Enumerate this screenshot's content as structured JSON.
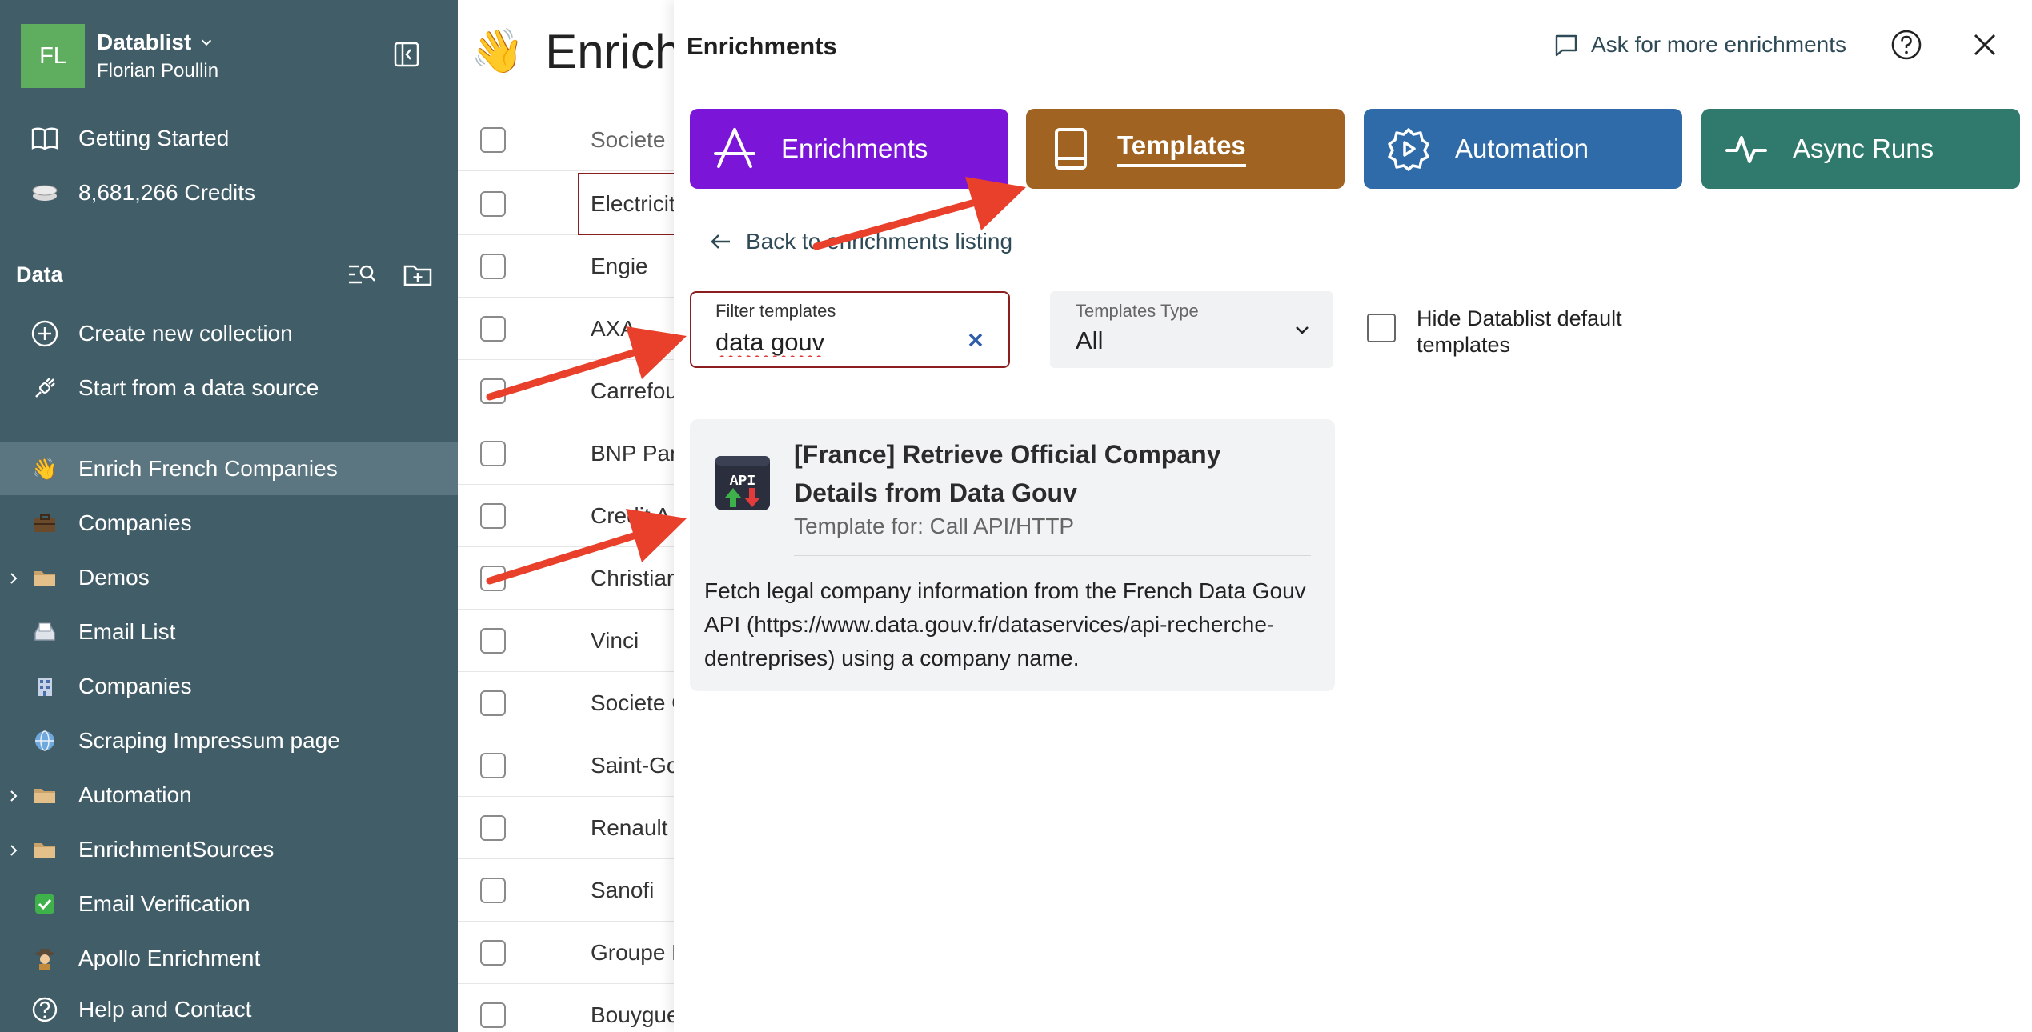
{
  "user": {
    "initials": "FL",
    "workspace": "Datablist",
    "name": "Florian Poullin"
  },
  "sidebar": {
    "top_items": [
      {
        "label": "Getting Started",
        "icon": "book-icon"
      },
      {
        "label": "8,681,266 Credits",
        "icon": "coins-icon"
      }
    ],
    "section_title": "Data",
    "actions": [
      {
        "label": "Create new collection",
        "icon": "plus-circle-icon"
      },
      {
        "label": "Start from a data source",
        "icon": "plug-icon"
      }
    ],
    "collections": [
      {
        "label": "Enrich French Companies",
        "icon": "waving-hand-icon",
        "active": true
      },
      {
        "label": "Companies",
        "icon": "briefcase-icon"
      },
      {
        "label": "Demos",
        "icon": "folder-icon",
        "folder": true
      },
      {
        "label": "Email List",
        "icon": "inbox-tray-icon"
      },
      {
        "label": "Companies",
        "icon": "office-building-icon"
      },
      {
        "label": "Scraping Impressum page",
        "icon": "globe-icon"
      },
      {
        "label": "Automation",
        "icon": "folder-icon",
        "folder": true
      },
      {
        "label": "EnrichmentSources",
        "icon": "folder-icon",
        "folder": true
      },
      {
        "label": "Email Verification",
        "icon": "check-mark-icon"
      },
      {
        "label": "Apollo Enrichment",
        "icon": "detective-icon"
      }
    ],
    "help_label": "Help and Contact"
  },
  "main": {
    "title": "Enrich",
    "column_header": "Societe",
    "rows": [
      "Electricit",
      "Engie",
      "AXA",
      "Carrefou",
      "BNP Par",
      "Credit A",
      "Christian",
      "Vinci",
      "Societe G",
      "Saint-Go",
      "Renault",
      "Sanofi",
      "Groupe E",
      "Bouygue"
    ]
  },
  "panel": {
    "title": "Enrichments",
    "ask_label": "Ask for more enrichments",
    "tabs": [
      {
        "label": "Enrichments"
      },
      {
        "label": "Templates",
        "active": true
      },
      {
        "label": "Automation"
      },
      {
        "label": "Async Runs"
      }
    ],
    "back_label": "Back to enrichments listing",
    "filter": {
      "label": "Filter templates",
      "value": "data gouv"
    },
    "type": {
      "label": "Templates Type",
      "value": "All"
    },
    "hide_default_label": "Hide Datablist default templates",
    "card": {
      "icon_text": "API",
      "title": "[France] Retrieve Official Company Details from Data Gouv",
      "subtitle": "Template for: Call API/HTTP",
      "description": "Fetch legal company information from the French Data Gouv API (https://www.data.gouv.fr/dataservices/api-recherche-dentreprises) using a company name."
    }
  },
  "colors": {
    "sidebar_bg": "#415d67",
    "enrichments_tab": "#7b16d9",
    "templates_tab": "#a06322",
    "automation_tab": "#2f6ba8",
    "async_tab": "#2f7a6c",
    "annotation_arrow": "#e8402a"
  }
}
